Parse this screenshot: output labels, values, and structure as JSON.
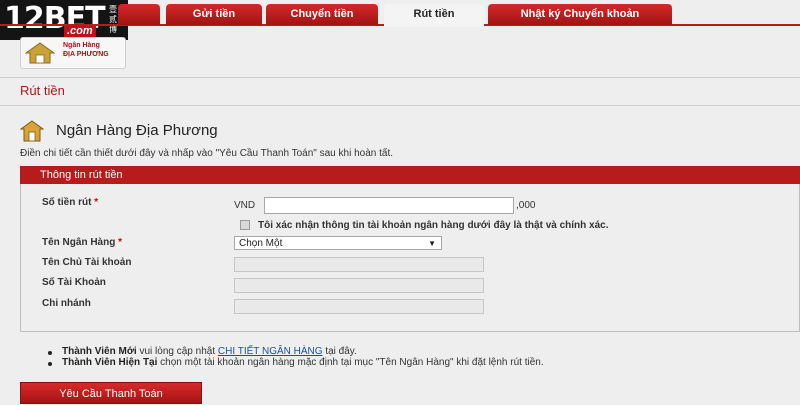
{
  "brand": {
    "name": "12BET",
    "cn": "壹贰博",
    "com": ".com"
  },
  "tabs": [
    {
      "label": "Gửi tiền"
    },
    {
      "label": "Chuyển tiền"
    },
    {
      "label": "Rút tiền"
    },
    {
      "label": "Nhật ký Chuyển khoản"
    }
  ],
  "active_tab": "Rút tiền",
  "bank_icon": {
    "label_line1": "Ngân Hàng",
    "label_line2": "ĐỊA PHƯƠNG"
  },
  "page_title": "Rút tiền",
  "section": {
    "title": "Ngân Hàng Địa Phương",
    "instructions": "Điền chi tiết cần thiết dưới đây và nhấp vào \"Yêu Cầu Thanh Toán\" sau khi hoàn tất."
  },
  "form": {
    "header": "Thông tin rút tiền",
    "amount_label": "Số tiền rút",
    "required_mark": "*",
    "currency": "VND",
    "amount_value": "",
    "amount_suffix": ",000",
    "confirm_label": "Tôi xác nhận thông tin tài khoản ngân hàng dưới đây là thật và chính xác.",
    "confirm_checked": false,
    "bank_name_label": "Tên Ngân Hàng",
    "bank_name_selected": "Chọn Một",
    "account_holder_label": "Tên Chủ Tài khoản",
    "account_number_label": "Số Tài Khoản",
    "branch_label": "Chi nhánh"
  },
  "notes": [
    {
      "bold": "Thành Viên Mới",
      "text_before": " vui lòng cập nhật ",
      "link": "CHI TIẾT NGÂN HÀNG",
      "text_after": " tại đây."
    },
    {
      "bold": "Thành Viên Hiện Tại",
      "text_before": " chọn một tài khoản ngân hàng mặc định tại mục \"Tên Ngân Hàng\" khi đặt lệnh rút tiền.",
      "link": "",
      "text_after": ""
    }
  ],
  "submit_label": "Yêu Cầu Thanh Toán",
  "colors": {
    "accent": "#b71c1c",
    "link": "#1a4fa8",
    "background": "#eeeeee"
  },
  "icons": [
    "house-bank-icon",
    "section-bank-icon",
    "chevron-down-icon"
  ]
}
